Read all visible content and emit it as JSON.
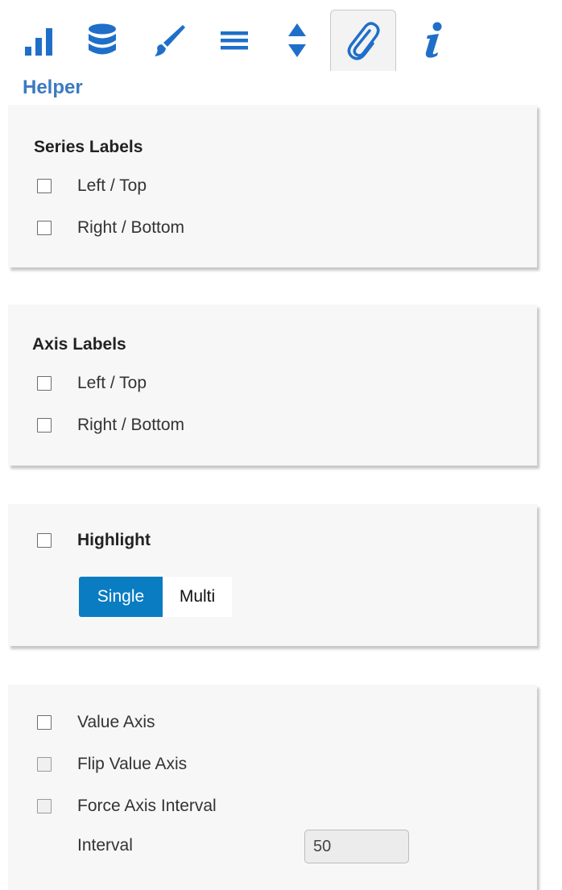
{
  "toolbar": {
    "tools": [
      {
        "icon": "bar-chart-icon"
      },
      {
        "icon": "database-icon"
      },
      {
        "icon": "brush-icon"
      },
      {
        "icon": "menu-lines-icon"
      },
      {
        "icon": "sort-arrows-icon"
      },
      {
        "icon": "paperclip-icon",
        "active": true
      },
      {
        "icon": "info-icon"
      }
    ],
    "accent": "#1f6fc9"
  },
  "helper": {
    "title": "Helper"
  },
  "series_labels": {
    "title": "Series Labels",
    "items": [
      {
        "label": "Left / Top",
        "checked": false
      },
      {
        "label": "Right / Bottom",
        "checked": false
      }
    ]
  },
  "axis_labels": {
    "title": "Axis Labels",
    "items": [
      {
        "label": "Left / Top",
        "checked": false
      },
      {
        "label": "Right / Bottom",
        "checked": false
      }
    ]
  },
  "highlight": {
    "label": "Highlight",
    "checked": false,
    "options": [
      "Single",
      "Multi"
    ],
    "selected": "Single",
    "selected_color": "#0a7cc2"
  },
  "value_axis": {
    "items": [
      {
        "label": "Value Axis",
        "checked": false
      },
      {
        "label": "Flip Value Axis",
        "checked": false
      },
      {
        "label": "Force Axis Interval",
        "checked": false
      }
    ],
    "interval_label": "Interval",
    "interval_value": "50"
  }
}
